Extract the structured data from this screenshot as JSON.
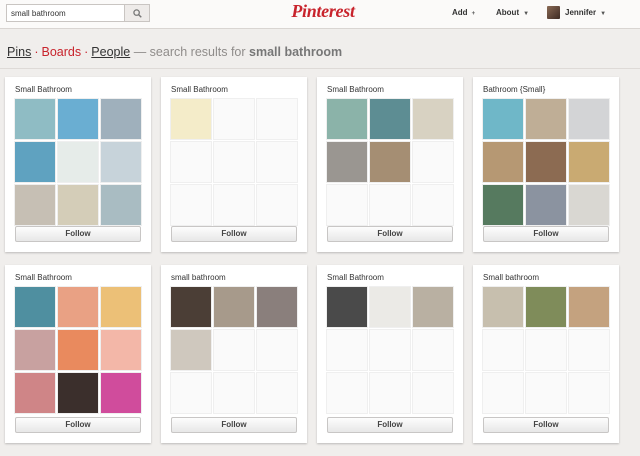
{
  "header": {
    "search": {
      "value": "small bathroom",
      "icon": "search-icon"
    },
    "logo": "Pinterest",
    "nav": {
      "add": "Add",
      "about": "About",
      "user": "Jennifer"
    }
  },
  "subtitle": {
    "pins": "Pins",
    "boards": "Boards",
    "people": "People",
    "prefix": "— search results for",
    "query": "small bathroom"
  },
  "follow_label": "Follow",
  "colors": {
    "brand": "#c8232c",
    "empty_thumb": "#fafafa"
  },
  "boards": [
    {
      "title": "Small Bathroom",
      "thumbs": [
        "#8fbcc4",
        "#6aaed2",
        "#9fb0bc",
        "#5fa2c0",
        "#e6ece9",
        "#c7d3da",
        "#c6bfb4",
        "#d4cdb8",
        "#a9bcc2"
      ]
    },
    {
      "title": "Small Bathroom",
      "thumbs": [
        "#f4ecc9",
        "#fafafa",
        "#fafafa",
        "#fafafa",
        "#fafafa",
        "#fafafa",
        "#fafafa",
        "#fafafa",
        "#fafafa"
      ]
    },
    {
      "title": "Small Bathroom",
      "thumbs": [
        "#8bb3a9",
        "#5d8d93",
        "#d8d2c2",
        "#9a9691",
        "#a58e73",
        "#fafafa",
        "#fafafa",
        "#fafafa",
        "#fafafa"
      ]
    },
    {
      "title": "Bathroom {Small}",
      "thumbs": [
        "#6fb7c8",
        "#bfae96",
        "#d3d4d6",
        "#b69873",
        "#8c6b52",
        "#c9aa72",
        "#567a5f",
        "#8b93a0",
        "#d9d7d2"
      ]
    },
    {
      "title": "Small Bathroom",
      "thumbs": [
        "#4f8fa0",
        "#e9a184",
        "#ecc077",
        "#c8a1a0",
        "#e98a5e",
        "#f3b7a8",
        "#cf8587",
        "#3b2f2c",
        "#d04c9c"
      ]
    },
    {
      "title": "small bathroom",
      "thumbs": [
        "#4b3e36",
        "#a79a8b",
        "#8a7f7c",
        "#cfc8be",
        "#fafafa",
        "#fafafa",
        "#fafafa",
        "#fafafa",
        "#fafafa"
      ]
    },
    {
      "title": "Small Bathroom",
      "thumbs": [
        "#4a4a4a",
        "#ebeae6",
        "#b9b0a2",
        "#fafafa",
        "#fafafa",
        "#fafafa",
        "#fafafa",
        "#fafafa",
        "#fafafa"
      ]
    },
    {
      "title": "Small bathroom",
      "thumbs": [
        "#c7bfae",
        "#7f8c5a",
        "#c4a27f",
        "#fafafa",
        "#fafafa",
        "#fafafa",
        "#fafafa",
        "#fafafa",
        "#fafafa"
      ]
    }
  ]
}
